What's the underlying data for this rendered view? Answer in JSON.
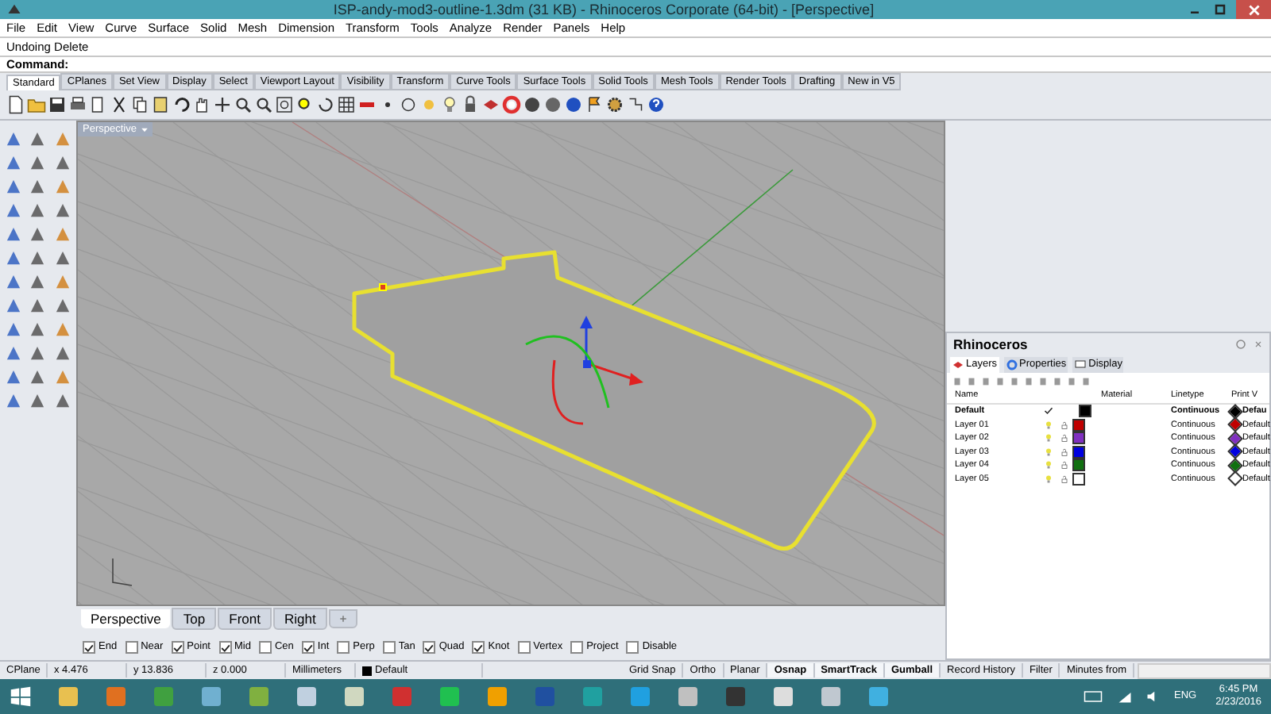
{
  "window": {
    "title": "ISP-andy-mod3-outline-1.3dm (31 KB) - Rhinoceros Corporate (64-bit) - [Perspective]"
  },
  "menu": [
    "File",
    "Edit",
    "View",
    "Curve",
    "Surface",
    "Solid",
    "Mesh",
    "Dimension",
    "Transform",
    "Tools",
    "Analyze",
    "Render",
    "Panels",
    "Help"
  ],
  "command_history": "Undoing Delete",
  "command_prompt": "Command:",
  "toolbar_tabs": [
    {
      "label": "Standard",
      "selected": true
    },
    {
      "label": "CPlanes",
      "selected": false
    },
    {
      "label": "Set View",
      "selected": false
    },
    {
      "label": "Display",
      "selected": false
    },
    {
      "label": "Select",
      "selected": false
    },
    {
      "label": "Viewport Layout",
      "selected": false
    },
    {
      "label": "Visibility",
      "selected": false
    },
    {
      "label": "Transform",
      "selected": false
    },
    {
      "label": "Curve Tools",
      "selected": false
    },
    {
      "label": "Surface Tools",
      "selected": false
    },
    {
      "label": "Solid Tools",
      "selected": false
    },
    {
      "label": "Mesh Tools",
      "selected": false
    },
    {
      "label": "Render Tools",
      "selected": false
    },
    {
      "label": "Drafting",
      "selected": false
    },
    {
      "label": "New in V5",
      "selected": false
    }
  ],
  "viewport": {
    "label": "Perspective"
  },
  "viewport_tabs": [
    {
      "label": "Perspective",
      "selected": true
    },
    {
      "label": "Top",
      "selected": false
    },
    {
      "label": "Front",
      "selected": false
    },
    {
      "label": "Right",
      "selected": false
    }
  ],
  "osnaps": [
    {
      "label": "End",
      "checked": true
    },
    {
      "label": "Near",
      "checked": false
    },
    {
      "label": "Point",
      "checked": true
    },
    {
      "label": "Mid",
      "checked": true
    },
    {
      "label": "Cen",
      "checked": false
    },
    {
      "label": "Int",
      "checked": true
    },
    {
      "label": "Perp",
      "checked": false
    },
    {
      "label": "Tan",
      "checked": false
    },
    {
      "label": "Quad",
      "checked": true
    },
    {
      "label": "Knot",
      "checked": true
    },
    {
      "label": "Vertex",
      "checked": false
    },
    {
      "label": "Project",
      "checked": false
    },
    {
      "label": "Disable",
      "checked": false
    }
  ],
  "status_bar": {
    "cplane": "CPlane",
    "x": "x 4.476",
    "y": "y 13.836",
    "z": "z 0.000",
    "units": "Millimeters",
    "layer": {
      "name": "Default",
      "color": "#000000"
    },
    "toggles": [
      {
        "label": "Grid Snap",
        "on": false
      },
      {
        "label": "Ortho",
        "on": false
      },
      {
        "label": "Planar",
        "on": false
      },
      {
        "label": "Osnap",
        "on": true
      },
      {
        "label": "SmartTrack",
        "on": true
      },
      {
        "label": "Gumball",
        "on": true
      },
      {
        "label": "Record History",
        "on": false
      },
      {
        "label": "Filter",
        "on": false
      },
      {
        "label": "Minutes from",
        "on": false
      }
    ]
  },
  "panel": {
    "title": "Rhinoceros",
    "tabs": [
      {
        "label": "Layers",
        "selected": true
      },
      {
        "label": "Properties",
        "selected": false
      },
      {
        "label": "Display",
        "selected": false
      }
    ],
    "columns": [
      "Name",
      "Material",
      "Linetype",
      "Print V"
    ],
    "layers": [
      {
        "name": "Default",
        "current": true,
        "color": "#000000",
        "linetype": "Continuous",
        "print": {
          "color": "#000000",
          "width": "Defau"
        }
      },
      {
        "name": "Layer 01",
        "current": false,
        "color": "#c00000",
        "linetype": "Continuous",
        "print": {
          "color": "#c00000",
          "width": "Default"
        }
      },
      {
        "name": "Layer 02",
        "current": false,
        "color": "#8030c0",
        "linetype": "Continuous",
        "print": {
          "color": "#8030c0",
          "width": "Default"
        }
      },
      {
        "name": "Layer 03",
        "current": false,
        "color": "#0000e0",
        "linetype": "Continuous",
        "print": {
          "color": "#0000e0",
          "width": "Default"
        }
      },
      {
        "name": "Layer 04",
        "current": false,
        "color": "#107010",
        "linetype": "Continuous",
        "print": {
          "color": "#107010",
          "width": "Default"
        }
      },
      {
        "name": "Layer 05",
        "current": false,
        "color": "#ffffff",
        "linetype": "Continuous",
        "print": {
          "color": "#ffffff",
          "width": "Default"
        }
      }
    ]
  },
  "taskbar": {
    "language": "ENG",
    "time": "6:45 PM",
    "date": "2/23/2016"
  }
}
